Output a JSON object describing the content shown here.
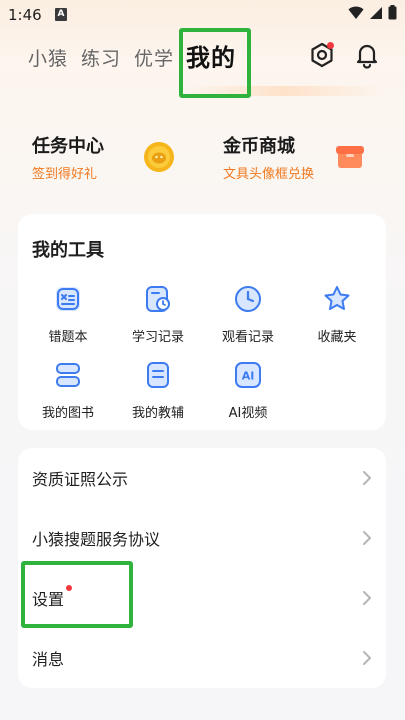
{
  "status": {
    "time": "1:46",
    "notif_letter": "A"
  },
  "nav": {
    "tabs": [
      "小猿",
      "练习",
      "优学",
      "我的"
    ],
    "active_index": 3
  },
  "quick": {
    "task": {
      "title": "任务中心",
      "subtitle": "签到得好礼"
    },
    "store": {
      "title": "金币商城",
      "subtitle": "文具头像框兑换"
    }
  },
  "tools": {
    "title": "我的工具",
    "items": [
      {
        "label": "错题本",
        "icon": "wrong-answers-icon"
      },
      {
        "label": "学习记录",
        "icon": "study-record-icon"
      },
      {
        "label": "观看记录",
        "icon": "watch-history-icon"
      },
      {
        "label": "收藏夹",
        "icon": "favorites-star-icon"
      },
      {
        "label": "我的图书",
        "icon": "books-icon"
      },
      {
        "label": "我的教辅",
        "icon": "study-materials-icon"
      },
      {
        "label": "AI视频",
        "icon": "ai-video-icon"
      }
    ]
  },
  "menu": {
    "items": [
      "资质证照公示",
      "小猿搜题服务协议",
      "设置",
      "消息"
    ]
  },
  "colors": {
    "accent_orange": "#f07a21",
    "tool_blue": "#3d7bf0",
    "highlight_green": "#2fb33d"
  }
}
